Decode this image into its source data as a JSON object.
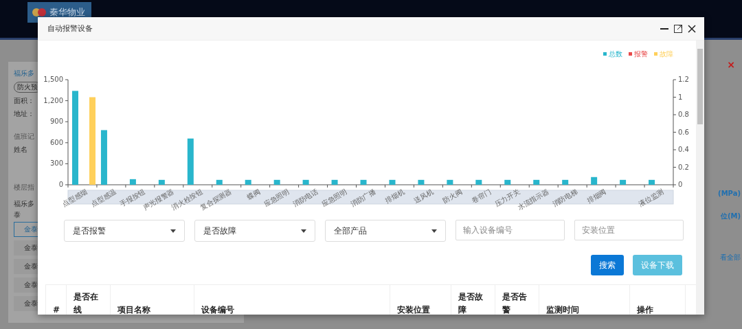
{
  "background": {
    "brand": "秦华物业",
    "close_mark": "×",
    "left_panel": {
      "title": "福乐多",
      "tag": "防火预",
      "area": "面积：",
      "address": "地址：",
      "duty_title": "值班记",
      "duty_column": "姓名",
      "floor_title": "楼层指",
      "floor_name": "福乐多",
      "floor_name_2": "泰",
      "floors": [
        {
          "label": "金泰",
          "selected": true
        },
        {
          "label": "金泰",
          "selected": false
        },
        {
          "label": "金泰",
          "selected": false
        },
        {
          "label": "金泰",
          "selected": false
        },
        {
          "label": "金泰",
          "selected": false
        }
      ]
    },
    "right_panel": {
      "pressure": "(MPa)",
      "level": "位(M)",
      "view_all": "看全部"
    }
  },
  "dialog": {
    "title": "自动报警设备",
    "chart": {
      "chart_data": {
        "type": "bar",
        "legend": "top-right",
        "categories": [
          "点型感烟",
          "点型感温",
          "手报按钮",
          "声光报警器",
          "消火栓按钮",
          "复合探测器",
          "蝶阀",
          "应急照明",
          "消防电话",
          "应急照明",
          "消防广播",
          "排烟机",
          "送风机",
          "防火阀",
          "卷帘门",
          "压力开关",
          "水流指示器",
          "消防电梯",
          "排烟阀",
          null,
          "液位监测"
        ],
        "series": [
          {
            "name": "总数",
            "color": "#29b6cc",
            "values": [
              1340,
              780,
              80,
              70,
              660,
              70,
              70,
              70,
              70,
              70,
              70,
              70,
              70,
              70,
              70,
              70,
              70,
              70,
              110,
              70,
              70
            ]
          },
          {
            "name": "报警",
            "color": "#e84a4a",
            "values": [
              0,
              0,
              0,
              0,
              0,
              0,
              0,
              0,
              0,
              0,
              0,
              0,
              0,
              0,
              0,
              0,
              0,
              0,
              0,
              0,
              0
            ]
          },
          {
            "name": "故障",
            "color": "#ffd05b",
            "axis": "y2",
            "values": [
              1,
              0,
              0,
              0,
              0,
              0,
              0,
              0,
              0,
              0,
              0,
              0,
              0,
              0,
              0,
              0,
              0,
              0,
              0,
              0,
              0
            ]
          }
        ],
        "ylim": [
          0,
          1500
        ],
        "yticks": [
          {
            "value": 0,
            "label": "0"
          },
          {
            "value": 300,
            "label": "300"
          },
          {
            "value": 600,
            "label": "600"
          },
          {
            "value": 900,
            "label": "900"
          },
          {
            "value": 1200,
            "label": "1,200"
          },
          {
            "value": 1500,
            "label": "1,500"
          }
        ],
        "y2lim": [
          0,
          1.2
        ],
        "y2ticks": [
          {
            "value": 0,
            "label": "0"
          },
          {
            "value": 0.2,
            "label": "0.2"
          },
          {
            "value": 0.4,
            "label": "0.4"
          },
          {
            "value": 0.6,
            "label": "0.6"
          },
          {
            "value": 0.8,
            "label": "0.8"
          },
          {
            "value": 1,
            "label": "1"
          },
          {
            "value": 1.2,
            "label": "1.2"
          }
        ]
      }
    },
    "filters": [
      {
        "kind": "select",
        "value": "是否报警"
      },
      {
        "kind": "select",
        "value": "是否故障"
      },
      {
        "kind": "select",
        "value": "全部产品"
      },
      {
        "kind": "input",
        "placeholder": "输入设备编号"
      },
      {
        "kind": "input",
        "placeholder": "安装位置"
      }
    ],
    "buttons": [
      {
        "label": "搜索",
        "kind": "primary"
      },
      {
        "label": "设备下载",
        "kind": "info"
      }
    ],
    "table": {
      "columns": [
        "#",
        "是否在线",
        "项目名称",
        "设备编号",
        "安装位置",
        "是否故障",
        "是否告警",
        "监测时间",
        "操作"
      ]
    }
  }
}
